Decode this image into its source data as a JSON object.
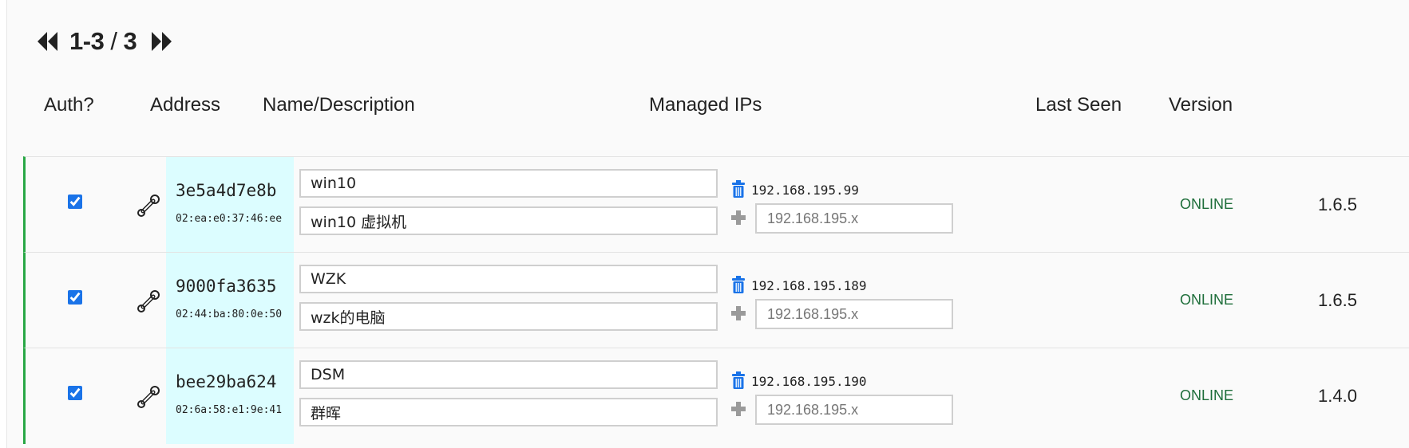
{
  "pager": {
    "range": "1-3",
    "separator": "/",
    "total": "3",
    "prev_icon": "double-chevron-left-icon",
    "next_icon": "double-chevron-right-icon"
  },
  "columns": {
    "auth": "Auth?",
    "address": "Address",
    "name": "Name/Description",
    "ips": "Managed IPs",
    "last_seen": "Last Seen",
    "version": "Version"
  },
  "colors": {
    "row_accent": "#28a745",
    "address_bg": "#dcfdff",
    "online": "#1e6e3a",
    "trash": "#1a73e8"
  },
  "ip_placeholder": "192.168.195.x",
  "members": [
    {
      "authorized": true,
      "node_id": "3e5a4d7e8b",
      "mac": "02:ea:e0:37:46:ee",
      "name": "win10",
      "description": "win10 虚拟机",
      "ip": "192.168.195.99",
      "status": "ONLINE",
      "version": "1.6.5"
    },
    {
      "authorized": true,
      "node_id": "9000fa3635",
      "mac": "02:44:ba:80:0e:50",
      "name": "WZK",
      "description": "wzk的电脑",
      "ip": "192.168.195.189",
      "status": "ONLINE",
      "version": "1.6.5"
    },
    {
      "authorized": true,
      "node_id": "bee29ba624",
      "mac": "02:6a:58:e1:9e:41",
      "name": "DSM",
      "description": "群晖",
      "ip": "192.168.195.190",
      "status": "ONLINE",
      "version": "1.4.0"
    }
  ]
}
